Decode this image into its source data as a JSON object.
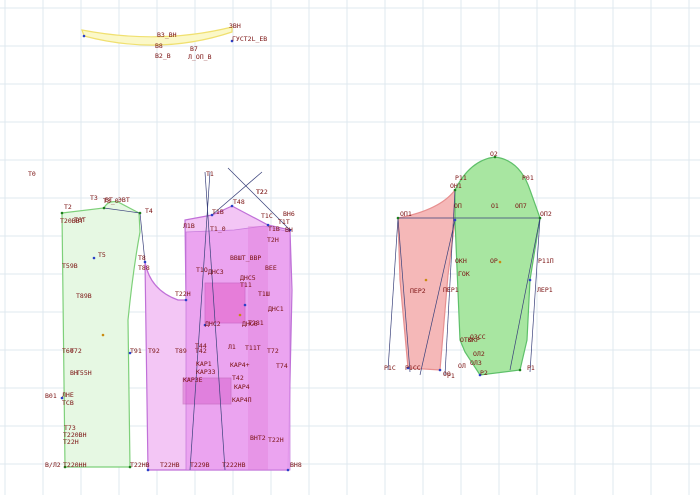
{
  "app": {
    "canvas_label": "pattern-drafting-canvas",
    "colors": {
      "grid": "#dfe9ef",
      "front": "#7ed07a",
      "front_fill": "#e6f8e3",
      "back": "#c070d8",
      "back_fill": "#ea9ff0",
      "back_fill_light": "#f3c6f5",
      "back_overlay": "#e04fbf",
      "sleeve_left": "#e79090",
      "sleeve_left_fill": "#f5b8b8",
      "sleeve_right": "#5fc06a",
      "sleeve_right_fill": "#a8e6a1",
      "collar": "#f0e070",
      "collar_fill": "#fbf8c8",
      "construction": "#39407a",
      "label": "#7a1111",
      "point_green": "#1b7d1b",
      "point_blue": "#2a3fc7",
      "point_orange": "#c98b10"
    }
  },
  "labels": {
    "collar": [
      "В3_ВН",
      "3ВН",
      "ГУСТ2L_ЕВ",
      "В8",
      "В7",
      "В2_В",
      "Л_ОП_В"
    ],
    "front": [
      "Т2",
      "Т3",
      "Т3_0",
      "ЭВТ",
      "Т20ВВТ",
      "Т4",
      "Т5",
      "Т59В",
      "Т8",
      "Т88",
      "Т89В",
      "Т91",
      "Т92",
      "Т55Н",
      "Т60",
      "ЛНЕ",
      "ТСВ",
      "Т72",
      "Т220ВН",
      "Т22Н",
      "Т73",
      "В/Л2",
      "Т220НН",
      "Т22НВ",
      "В01",
      "ВН",
      "Т6Т",
      "ВТ"
    ],
    "back": [
      "Т1",
      "Т48",
      "Т22",
      "Т1В",
      "Т1О",
      "Л1В",
      "ДНС3",
      "ДНС5",
      "Т11",
      "ДНС2",
      "Т22Н",
      "Т89",
      "Т42",
      "Т44",
      "КАР1",
      "КАРЗ3",
      "ДНС1",
      "Л1",
      "Т1Т",
      "Т1С",
      "ВН6",
      "Т42",
      "КАР3Е",
      "КАР4",
      "КАР4П",
      "КАР4+",
      "ДНС6",
      "Т11Т",
      "Т2Н",
      "Т1_0",
      "Т72",
      "Т74",
      "Т22НВ",
      "Т229В",
      "Т222НВ",
      "ВНТ2",
      "ВН8",
      "Т22Н",
      "ВЕЕ",
      "Т1В",
      "ВВШТ_ВВР",
      "ВН",
      "Т1Ш",
      "Т281"
    ],
    "sleeve": [
      "О2",
      "Р01",
      "ОН1",
      "О1",
      "Р11",
      "ОП",
      "ОП2",
      "ОП1",
      "ОП7",
      "Р11П",
      "ОР",
      "ГОК",
      "ОКН",
      "ПЕР2",
      "ОЛ",
      "ОО",
      "ЛЕР1",
      "ПЕР1",
      "Р1",
      "Р2",
      "ОТК",
      "ОКР",
      "Р1С",
      "Р1СС",
      "ОЗСС",
      "ОЛ2",
      "ОЛ3",
      "Р1"
    ],
    "misc": [
      "Т0",
      "Т2"
    ]
  }
}
